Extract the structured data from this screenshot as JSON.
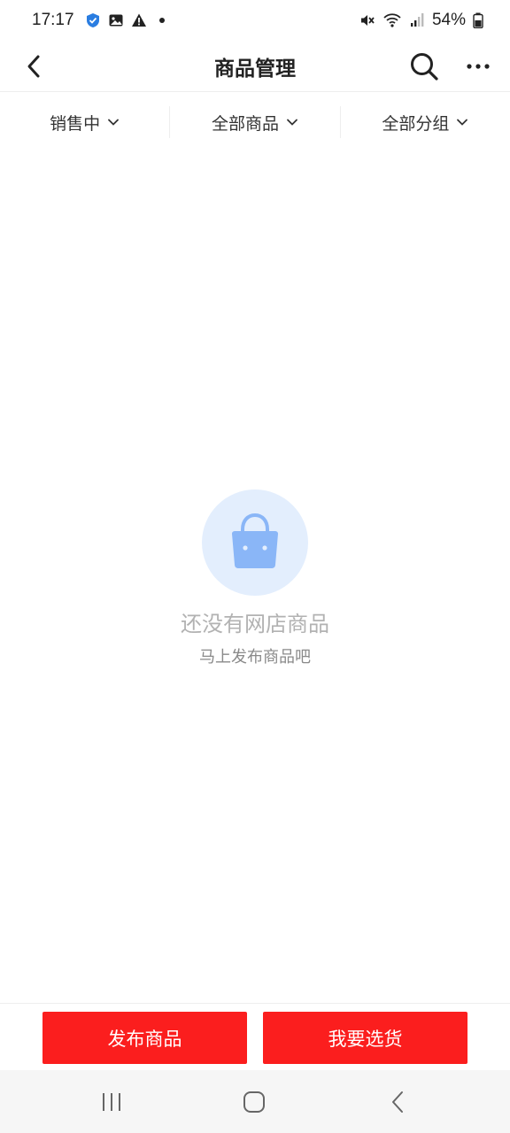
{
  "status_bar": {
    "time": "17:17",
    "battery": "54%",
    "left_icons": [
      "shield-check-icon",
      "image-icon",
      "warning-icon",
      "dot-icon"
    ],
    "right_icons": [
      "mute-icon",
      "wifi-icon",
      "signal-icon",
      "battery-icon"
    ]
  },
  "nav": {
    "title": "商品管理",
    "back_icon": "chevron-left-icon",
    "search_icon": "search-icon",
    "more_icon": "more-icon"
  },
  "filters": [
    {
      "label": "销售中"
    },
    {
      "label": "全部商品"
    },
    {
      "label": "全部分组"
    }
  ],
  "empty_state": {
    "icon": "shopping-bag-icon",
    "title": "还没有网店商品",
    "subtitle": "马上发布商品吧"
  },
  "actions": {
    "publish_label": "发布商品",
    "select_label": "我要选货"
  },
  "colors": {
    "accent": "#fb1e1e",
    "empty_circle": "#e3eefd",
    "bag": "#8ab6f7"
  }
}
